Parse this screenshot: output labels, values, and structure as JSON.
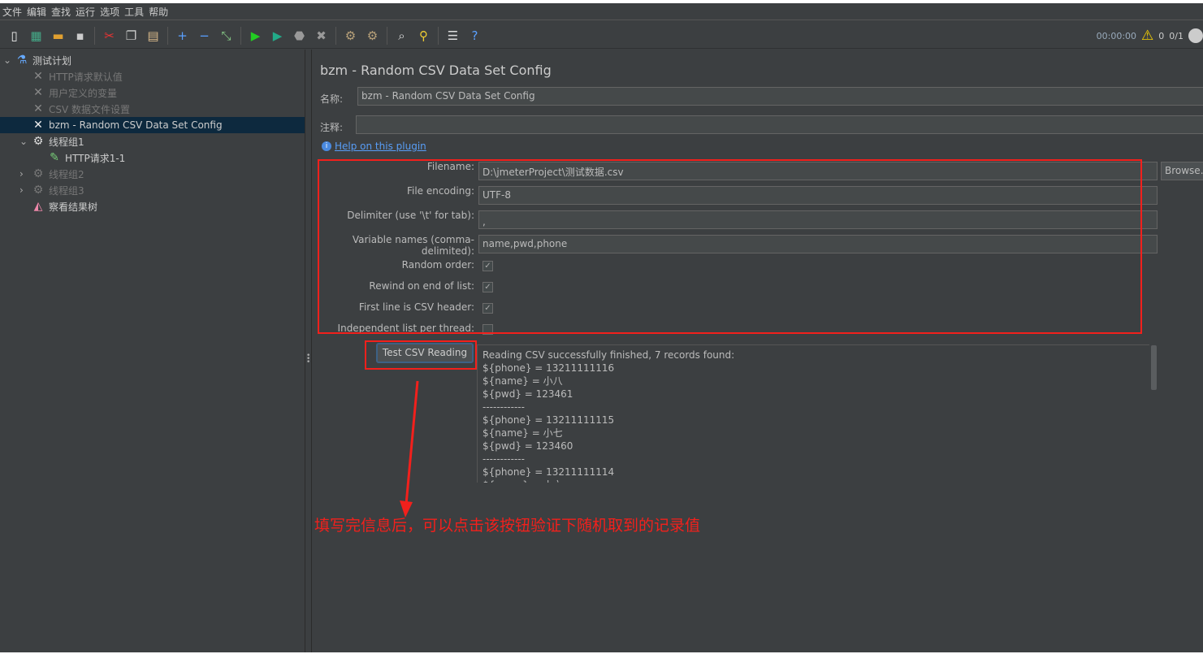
{
  "menu": [
    "文件",
    "编辑",
    "查找",
    "运行",
    "选项",
    "工具",
    "帮助"
  ],
  "toolbar": [
    {
      "icon": "new-icon",
      "g": "▯",
      "c": "#eee"
    },
    {
      "icon": "templates-icon",
      "g": "▦",
      "c": "#4a8"
    },
    {
      "icon": "open-icon",
      "g": "▬",
      "c": "#e0a030"
    },
    {
      "icon": "save-icon",
      "g": "▪",
      "c": "#ccc"
    },
    {
      "sep": true
    },
    {
      "icon": "cut-icon",
      "g": "✂",
      "c": "#e33"
    },
    {
      "icon": "copy-icon",
      "g": "❐",
      "c": "#ccc"
    },
    {
      "icon": "paste-icon",
      "g": "▤",
      "c": "#d9b98a"
    },
    {
      "sep": true
    },
    {
      "icon": "expand-icon",
      "g": "+",
      "c": "#5aa0ff"
    },
    {
      "icon": "collapse-icon",
      "g": "−",
      "c": "#5aa0ff"
    },
    {
      "icon": "toggle-icon",
      "g": "⤡",
      "c": "#8c8"
    },
    {
      "sep": true
    },
    {
      "icon": "start-icon",
      "g": "▶",
      "c": "#2c2"
    },
    {
      "icon": "start-no-pause-icon",
      "g": "▶",
      "c": "#2a8"
    },
    {
      "icon": "stop-icon",
      "g": "⬣",
      "c": "#999"
    },
    {
      "icon": "shutdown-icon",
      "g": "✖",
      "c": "#999"
    },
    {
      "sep": true
    },
    {
      "icon": "clear-icon",
      "g": "⚙",
      "c": "#b9a27a"
    },
    {
      "icon": "clear-all-icon",
      "g": "⚙",
      "c": "#b9a27a"
    },
    {
      "sep": true
    },
    {
      "icon": "search-icon",
      "g": "⌕",
      "c": "#ddd"
    },
    {
      "icon": "reset-search-icon",
      "g": "⚲",
      "c": "#ec3"
    },
    {
      "sep": true
    },
    {
      "icon": "function-helper-icon",
      "g": "☰",
      "c": "#ddd"
    },
    {
      "icon": "help-icon",
      "g": "?",
      "c": "#5aa0ff"
    }
  ],
  "status": {
    "timer": "00:00:00",
    "warnings": "0",
    "threads": "0/1"
  },
  "tree": [
    {
      "label": "测试计划",
      "icon": "test-plan-icon",
      "g": "⚗",
      "c": "#6af",
      "level": 0,
      "chev": "⌄",
      "dis": false
    },
    {
      "label": "HTTP请求默认值",
      "icon": "config-wrench-icon",
      "g": "✕",
      "c": "#888",
      "level": 1,
      "dis": true
    },
    {
      "label": "用户定义的变量",
      "icon": "config-wrench-icon",
      "g": "✕",
      "c": "#888",
      "level": 1,
      "dis": true
    },
    {
      "label": "CSV 数据文件设置",
      "icon": "config-wrench-icon",
      "g": "✕",
      "c": "#888",
      "level": 1,
      "dis": true
    },
    {
      "label": "bzm - Random CSV Data Set Config",
      "icon": "config-wrench-icon",
      "g": "✕",
      "c": "#eee",
      "level": 1,
      "dis": false,
      "sel": true
    },
    {
      "label": "线程组1",
      "icon": "thread-group-icon",
      "g": "⚙",
      "c": "#ddd",
      "level": 1,
      "chev": "⌄",
      "dis": false
    },
    {
      "label": "HTTP请求1-1",
      "icon": "sampler-pipette-icon",
      "g": "✎",
      "c": "#7c7",
      "level": 2,
      "dis": false
    },
    {
      "label": "线程组2",
      "icon": "thread-group-icon",
      "g": "⚙",
      "c": "#777",
      "level": 1,
      "chev": "›",
      "dis": true
    },
    {
      "label": "线程组3",
      "icon": "thread-group-icon",
      "g": "⚙",
      "c": "#777",
      "level": 1,
      "chev": "›",
      "dis": true
    },
    {
      "label": "察看结果树",
      "icon": "results-tree-icon",
      "g": "◭",
      "c": "#e8a",
      "level": 1,
      "dis": false
    }
  ],
  "panel": {
    "title": "bzm - Random CSV Data Set Config",
    "name_label": "名称:",
    "name_value": "bzm - Random CSV Data Set Config",
    "comment_label": "注释:",
    "comment_value": "",
    "help_link": "Help on this plugin",
    "filename_label": "Filename:",
    "filename_value": "D:\\jmeterProject\\测试数据.csv",
    "browse": "Browse...",
    "encoding_label": "File encoding:",
    "encoding_value": "UTF-8",
    "delimiter_label": "Delimiter (use '\\t' for tab):",
    "delimiter_value": ",",
    "varnames_label": "Variable names (comma-delimited):",
    "varnames_value": "name,pwd,phone",
    "random_label": "Random order:",
    "random": true,
    "rewind_label": "Rewind on end of list:",
    "rewind": true,
    "header_label": "First line is CSV header:",
    "header": true,
    "independent_label": "Independent list per thread:",
    "independent": false,
    "test_button": "Test CSV Reading",
    "output": [
      "Reading CSV successfully finished, 7 records found:",
      "${phone} = 13211111116",
      "${name} = 小八",
      "${pwd} = 123461",
      "------------",
      "${phone} = 13211111115",
      "${name} = 小七",
      "${pwd} = 123460",
      "------------",
      "${phone} = 13211111114",
      "${name} = 小六"
    ]
  },
  "annotation": "填写完信息后，可以点击该按钮验证下随机取到的记录值",
  "colors": {
    "annotation": "#f2201c",
    "selection": "#0d293e",
    "link": "#589df6"
  }
}
